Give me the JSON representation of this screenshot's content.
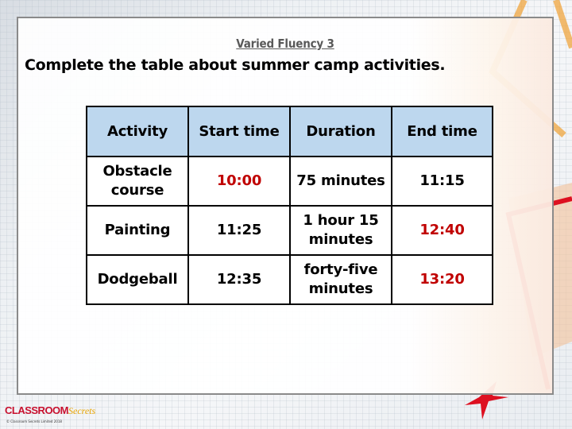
{
  "slide": {
    "title": "Varied Fluency 3",
    "instruction": "Complete the table about summer camp activities."
  },
  "table": {
    "headers": [
      "Activity",
      "Start time",
      "Duration",
      "End time"
    ],
    "rows": [
      {
        "activity": "Obstacle course",
        "start": "10:00",
        "duration": "75 minutes",
        "end": "11:15",
        "highlight": "start"
      },
      {
        "activity": "Painting",
        "start": "11:25",
        "duration": "1 hour 15 minutes",
        "end": "12:40",
        "highlight": "end"
      },
      {
        "activity": "Dodgeball",
        "start": "12:35",
        "duration": "forty-five minutes",
        "end": "13:20",
        "highlight": "end"
      }
    ]
  },
  "colors": {
    "header_fill": "#bdd7ee",
    "answer_red": "#c00000",
    "border": "#000000"
  },
  "footer": {
    "logo_main": "CLASSROOM",
    "logo_script": "Secrets",
    "copyright": "© Classroom Secrets Limited 2018"
  }
}
